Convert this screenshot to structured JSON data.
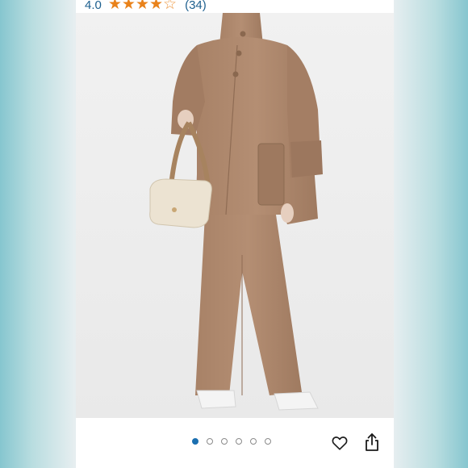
{
  "rating": {
    "value": "4.0",
    "stars": 4,
    "out_of": 5,
    "count": "(34)"
  },
  "carousel": {
    "total": 6,
    "active_index": 0
  },
  "colors": {
    "star": "#e9821a",
    "rating_text": "#1d5f8e",
    "active_dot": "#1b6fb0"
  },
  "icons": {
    "wishlist": "heart-outline-icon",
    "share": "share-icon"
  }
}
